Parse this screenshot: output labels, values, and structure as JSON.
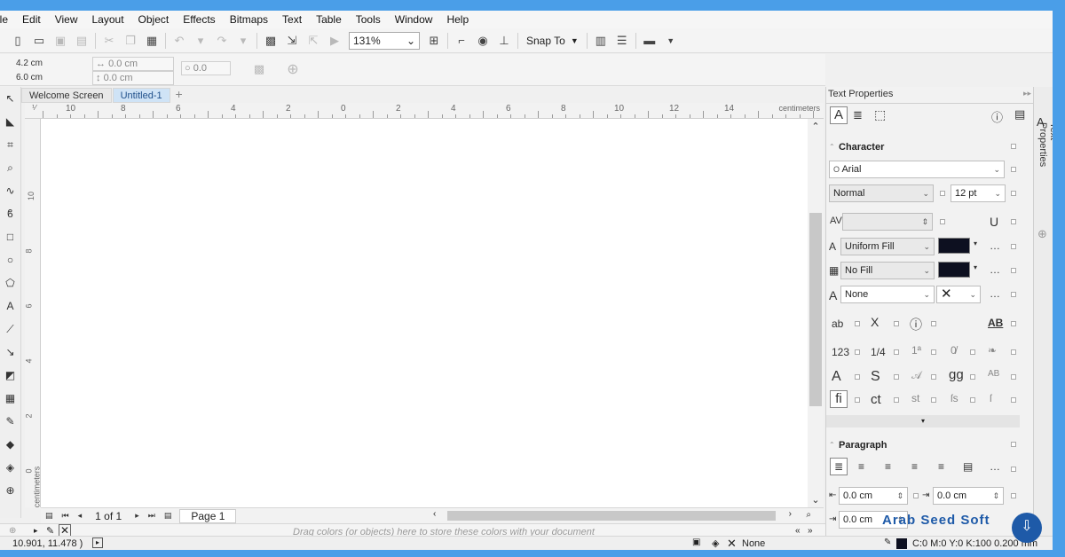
{
  "menu": [
    "ile",
    "Edit",
    "View",
    "Layout",
    "Object",
    "Effects",
    "Bitmaps",
    "Text",
    "Table",
    "Tools",
    "Window",
    "Help"
  ],
  "toolbar": {
    "zoom": "131%",
    "snap_label": "Snap To"
  },
  "property_bar": {
    "width": "4.2 cm",
    "height": "6.0 cm",
    "x_offset": "0.0 cm",
    "y_offset": "0.0 cm",
    "angle": "0.0"
  },
  "tabs": [
    "Welcome Screen",
    "Untitled-1"
  ],
  "ruler": {
    "h_labels": [
      "10",
      "8",
      "6",
      "4",
      "2",
      "0",
      "2",
      "4",
      "6",
      "8",
      "10",
      "12",
      "14"
    ],
    "h_unit": "centimeters",
    "v_labels": [
      "10",
      "8",
      "6",
      "4",
      "2",
      "0"
    ],
    "v_unit": "centimeters"
  },
  "page_nav": {
    "count": "1 of 1",
    "page_tab": "Page 1"
  },
  "palette_hint": "Drag colors (or objects) here to store these colors with your document",
  "status": {
    "coords": "10.901, 11.478 )",
    "fill_none": "None",
    "cmyk": "C:0 M:0 Y:0 K:100  0.200 mm"
  },
  "docker": {
    "title": "Text Properties",
    "side_label": "Text Properties",
    "character_heading": "Character",
    "font": "Arial",
    "style": "Normal",
    "size": "12 pt",
    "fill": "Uniform Fill",
    "bg_fill": "No Fill",
    "outline": "None",
    "row_ab": "ab",
    "row_x2": "X",
    "row_ab_ul": "AB",
    "row_123": "123",
    "row_quarter": "1/4",
    "row_A": "A",
    "row_S": "S",
    "row_gg": "gg",
    "row_fi": "fi",
    "row_ct": "ct",
    "row_st": "st",
    "paragraph_heading": "Paragraph",
    "indent_left": "0.0 cm",
    "indent_first": "0.0 cm",
    "indent_right": "0.0 cm"
  },
  "watermark": "Arab Seed Soft",
  "colors": {
    "accent": "#4a9ee8",
    "tab_active": "#cfe3f6",
    "swatch": "#0d1020"
  }
}
